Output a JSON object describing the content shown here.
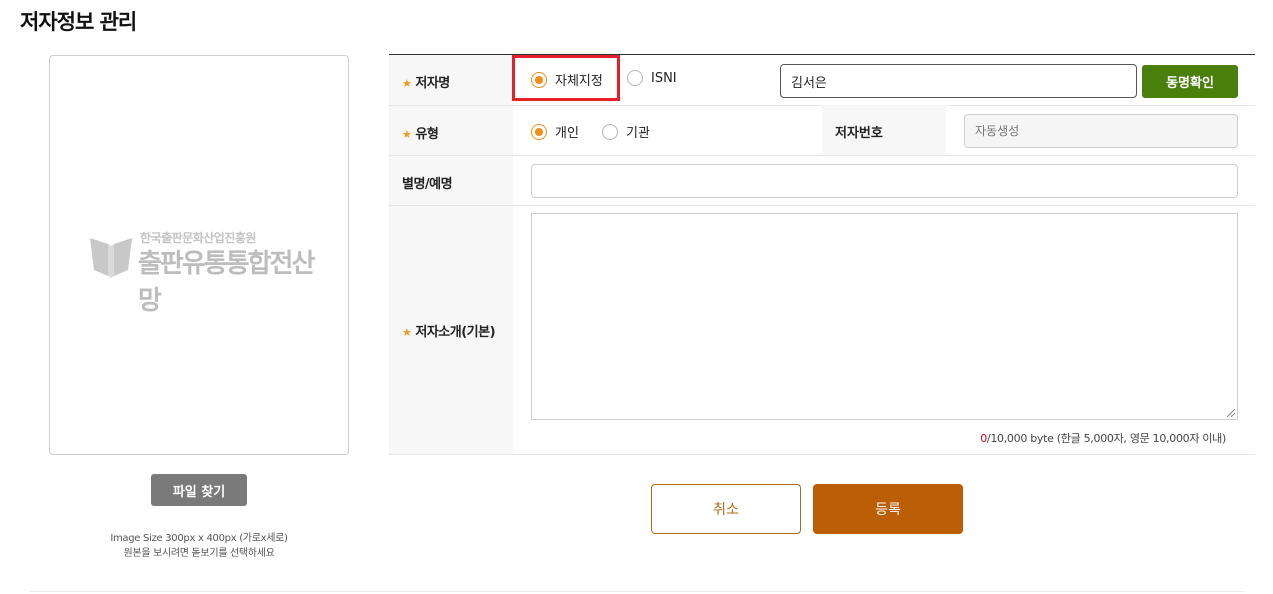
{
  "page": {
    "title": "저자정보 관리"
  },
  "image_panel": {
    "logo_small": "한국출판문화산업진흥원",
    "logo_big": "출판유통통합전산망",
    "file_button": "파일 찾기",
    "size_note": "Image Size 300px x 400px (가로x세로)",
    "view_note": "원본을 보시려면 돋보기를 선택하세요"
  },
  "form": {
    "author_name": {
      "label": "저자명",
      "options": [
        {
          "label": "자체지정",
          "checked": true
        },
        {
          "label": "ISNI",
          "checked": false
        }
      ],
      "value": "김서은",
      "check_button": "동명확인"
    },
    "type": {
      "label": "유형",
      "options": [
        {
          "label": "개인",
          "checked": true
        },
        {
          "label": "기관",
          "checked": false
        }
      ]
    },
    "author_number": {
      "label": "저자번호",
      "placeholder": "자동생성"
    },
    "alias": {
      "label": "별명/예명",
      "value": ""
    },
    "intro": {
      "label": "저자소개(기본)",
      "value": "",
      "byte_count": "0",
      "byte_limit": "/10,000 byte (한글 5,000자, 영문 10,000자 이내)"
    }
  },
  "actions": {
    "cancel": "취소",
    "submit": "등록"
  },
  "colors": {
    "accent_orange": "#ef8e1c",
    "check_green": "#4a7f0c",
    "submit_brown": "#bb5e06",
    "highlight_red": "#e4202a"
  }
}
